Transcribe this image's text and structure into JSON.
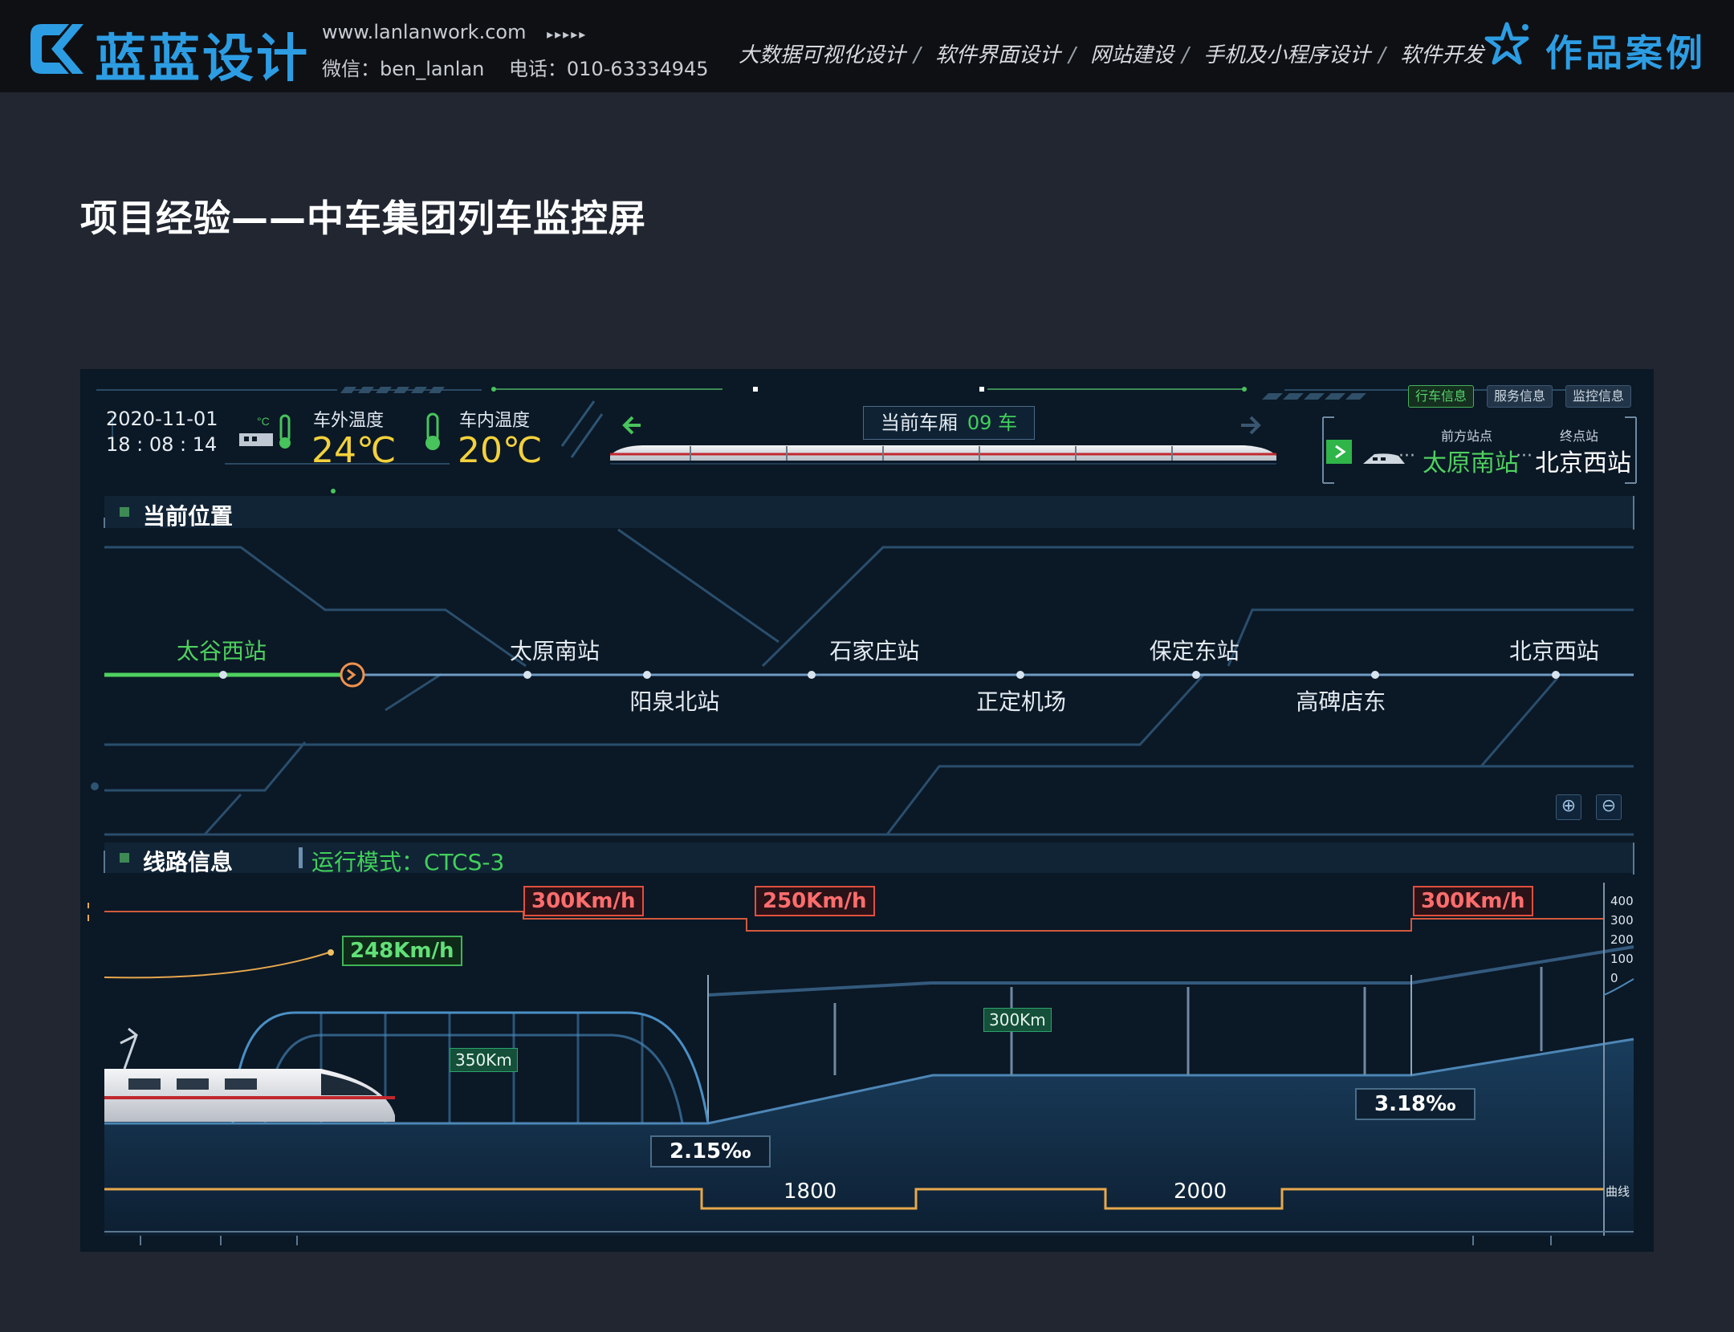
{
  "brand": {
    "name": "蓝蓝设计",
    "website": "www.lanlanwork.com",
    "arrows": "▸▸▸▸▸",
    "contact": "微信：ben_lanlan    电话：010-63334945",
    "services": [
      "大数据可视化设计",
      "软件界面设计",
      "网站建设",
      "手机及小程序设计",
      "软件开发"
    ],
    "case_label": "作品案例"
  },
  "page": {
    "title": "项目经验——中车集团列车监控屏"
  },
  "screen": {
    "date": "2020-11-01",
    "time": "18 : 08 : 14",
    "outside_temp": {
      "label": "车外温度",
      "value": "24℃"
    },
    "inside_temp": {
      "label": "车内温度",
      "value": "20℃"
    },
    "car": {
      "label": "当前车厢",
      "value": "09 车"
    },
    "tabs": [
      "行车信息",
      "服务信息",
      "监控信息"
    ],
    "next_station": {
      "front_label": "前方站点",
      "end_label": "终点站",
      "front": "太原南站",
      "end": "北京西站",
      "dots": "···"
    },
    "position": {
      "title": "当前位置",
      "stations": [
        {
          "name": "太谷西站",
          "progress": 0.0,
          "row": "top",
          "passed": true
        },
        {
          "name": "太原南站",
          "progress": 0.25,
          "row": "top"
        },
        {
          "name": "阳泉北站",
          "progress": 0.34,
          "row": "bottom"
        },
        {
          "name": "石家庄站",
          "progress": 0.49,
          "row": "top"
        },
        {
          "name": "正定机场",
          "progress": 0.6,
          "row": "bottom"
        },
        {
          "name": "保定东站",
          "progress": 0.73,
          "row": "top"
        },
        {
          "name": "高碑店东",
          "progress": 0.84,
          "row": "bottom"
        },
        {
          "name": "北京西站",
          "progress": 1.0,
          "row": "top"
        }
      ],
      "train_progress": 0.11
    },
    "route": {
      "title": "线路信息",
      "mode": "运行模式：CTCS-3",
      "speed_limits": [
        "300Km/h",
        "250Km/h",
        "300Km/h"
      ],
      "current_speed": "248Km/h",
      "tunnel_length": "350Km",
      "bridge_length": "300Km",
      "gradients": [
        "2.15‰",
        "3.18‰"
      ],
      "curve_radii": [
        "1800",
        "2000"
      ],
      "curve_label": "曲线",
      "speed_scale": [
        "400",
        "300",
        "200",
        "100",
        "0"
      ]
    }
  }
}
